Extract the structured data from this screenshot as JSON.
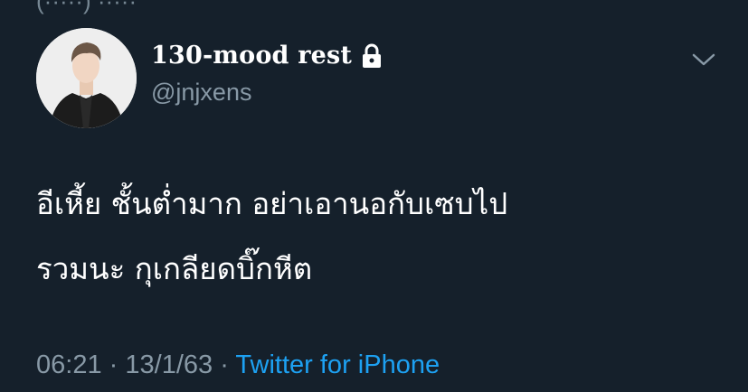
{
  "header_partial": "(·····) ·····",
  "tweet": {
    "display_name": "130-mood rest",
    "handle": "@jnjxens",
    "text_lines": [
      "อีเหี้ย ชั้นต่ำมาก อย่าเอานอกับเซบไป",
      "รวมนะ กุเกลียดบิ๊กหีต"
    ],
    "time": "06:21",
    "separator": "·",
    "date": "13/1/63",
    "source": "Twitter for iPhone",
    "protected_icon": "lock-icon",
    "menu_icon": "chevron-down-icon"
  },
  "colors": {
    "background": "#15202b",
    "text_primary": "#ffffff",
    "text_secondary": "#8899a6",
    "accent": "#1da1f2"
  }
}
